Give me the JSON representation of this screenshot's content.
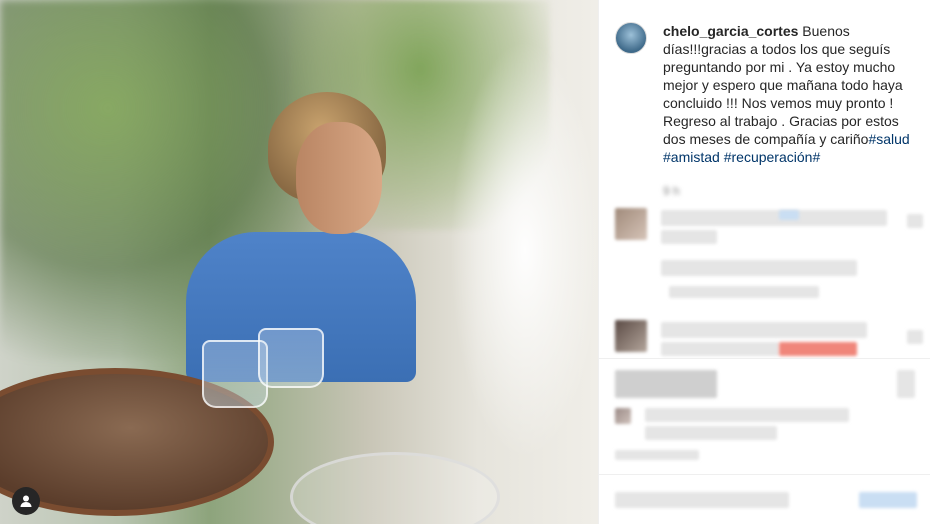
{
  "post": {
    "username": "chelo_garcia_cortes",
    "caption_text": "Buenos días!!!gracias a todos los que seguís preguntando por mi . Ya estoy mucho mejor y espero que mañana todo haya concluido !!! Nos vemos muy pronto ! Regreso al trabajo . Gracias por estos dos meses de compañía y cariño",
    "hashtags": [
      "#salud",
      "#amistad",
      "#recuperación",
      "#"
    ],
    "time_ago": "9 h"
  },
  "icons": {
    "user_tag": "user-tag-icon"
  }
}
